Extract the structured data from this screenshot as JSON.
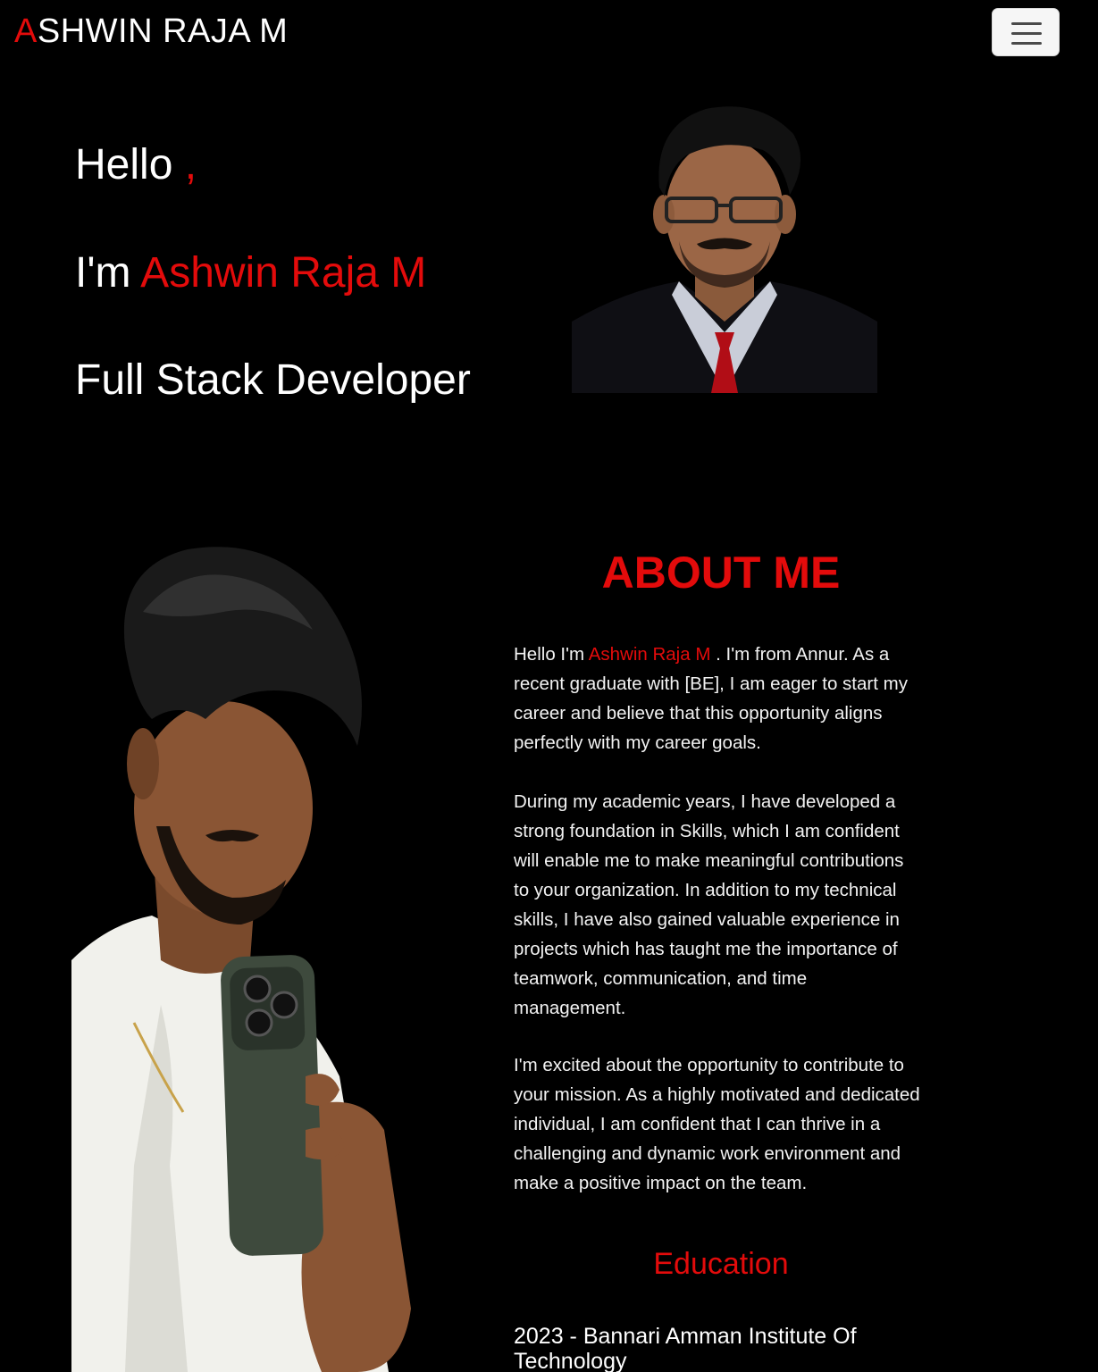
{
  "navbar": {
    "brand_first": "A",
    "brand_rest": "SHWIN RAJA M",
    "menu_icon": "hamburger-menu-icon"
  },
  "hero": {
    "hello": "Hello",
    "comma": ",",
    "im": "I'm",
    "name": "Ashwin Raja M",
    "role": "Full Stack Developer"
  },
  "about": {
    "title": "ABOUT ME",
    "p1_prefix": "Hello I'm",
    "p1_name": "Ashwin Raja M",
    "p1_rest": ". I'm from Annur. As a recent graduate with [BE], I am eager to start my career and believe that this opportunity aligns perfectly with my career goals.",
    "p2": "During my academic years, I have developed a strong foundation in Skills, which I am confident will enable me to make meaningful contributions to your organization. In addition to my technical skills, I have also gained valuable experience in projects which has taught me the importance of teamwork, communication, and time management.",
    "p3": "I'm excited about the opportunity to contribute to your mission. As a highly motivated and dedicated individual, I am confident that I can thrive in a challenging and dynamic work environment and make a positive impact on the team."
  },
  "education": {
    "title": "Education",
    "items": [
      "2023 - Bannari Amman Institute Of Technology"
    ]
  },
  "colors": {
    "accent": "#e30b0b",
    "background": "#000000"
  }
}
